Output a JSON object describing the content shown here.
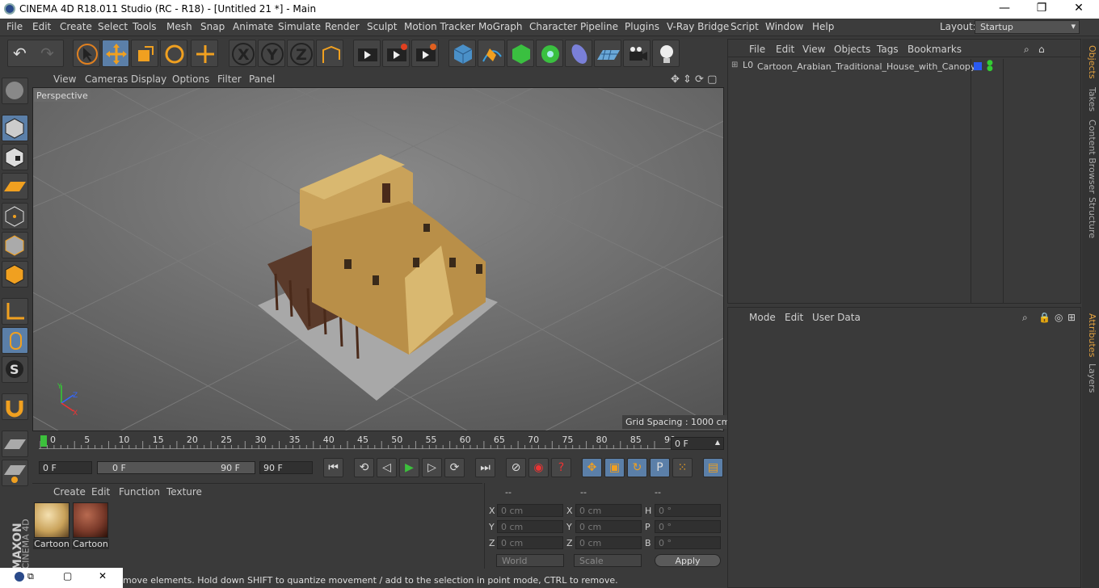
{
  "window": {
    "title": "CINEMA 4D R18.011 Studio (RC - R18) - [Untitled 21 *] - Main",
    "minimize": "—",
    "maximize": "❐",
    "close": "✕"
  },
  "menu": [
    "File",
    "Edit",
    "Create",
    "Select",
    "Tools",
    "Mesh",
    "Snap",
    "Animate",
    "Simulate",
    "Render",
    "Sculpt",
    "Motion Tracker",
    "MoGraph",
    "Character",
    "Pipeline",
    "Plugins",
    "V-Ray Bridge",
    "Script",
    "Window",
    "Help"
  ],
  "layout": {
    "label": "Layout:",
    "value": "Startup"
  },
  "viewport": {
    "menu": [
      "View",
      "Cameras",
      "Display",
      "Options",
      "Filter",
      "Panel"
    ],
    "camera": "Perspective",
    "grid_spacing": "Grid Spacing : 1000 cm",
    "axis": {
      "y": "Y",
      "z": "Z",
      "x": "X"
    }
  },
  "timeline": {
    "ticks": [
      "0",
      "5",
      "10",
      "15",
      "20",
      "25",
      "30",
      "35",
      "40",
      "45",
      "50",
      "55",
      "60",
      "65",
      "70",
      "75",
      "80",
      "85",
      "90"
    ],
    "current_frame": "0 F",
    "start": "0 F",
    "range_start": "0 F",
    "range_end": "90 F",
    "end": "90 F"
  },
  "materials": {
    "menu": [
      "Create",
      "Edit",
      "Function",
      "Texture"
    ],
    "items": [
      {
        "label": "Cartoon"
      },
      {
        "label": "Cartoon"
      }
    ]
  },
  "coords": {
    "headers": [
      "--",
      "--",
      "--"
    ],
    "rows": [
      {
        "a": "X",
        "av": "0 cm",
        "b": "X",
        "bv": "0 cm",
        "c": "H",
        "cv": "0 °"
      },
      {
        "a": "Y",
        "av": "0 cm",
        "b": "Y",
        "bv": "0 cm",
        "c": "P",
        "cv": "0 °"
      },
      {
        "a": "Z",
        "av": "0 cm",
        "b": "Z",
        "bv": "0 cm",
        "c": "B",
        "cv": "0 °"
      }
    ],
    "world": "World",
    "scale": "Scale",
    "apply": "Apply"
  },
  "objects": {
    "menu": [
      "File",
      "Edit",
      "View",
      "Objects",
      "Tags",
      "Bookmarks"
    ],
    "items": [
      {
        "name": "Cartoon_Arabian_Traditional_House_with_Canopy",
        "layer": "L0"
      }
    ]
  },
  "attributes": {
    "menu": [
      "Mode",
      "Edit",
      "User Data"
    ]
  },
  "side_tabs": [
    "Objects",
    "Takes",
    "Content Browser",
    "Structure",
    "Attributes",
    "Layers"
  ],
  "status": "Move: Click and drag to move elements. Hold down SHIFT to quantize movement / add to the selection in point mode, CTRL to remove.",
  "status_visible": "move elements. Hold down SHIFT to quantize movement / add to the selection in point mode, CTRL to remove.",
  "brand": {
    "maxon": "MAXON",
    "c4d": "CINEMA 4D"
  },
  "colors": {
    "accent": "#e0a040",
    "selected": "#5b7fa8",
    "play": "#3cc03c"
  }
}
